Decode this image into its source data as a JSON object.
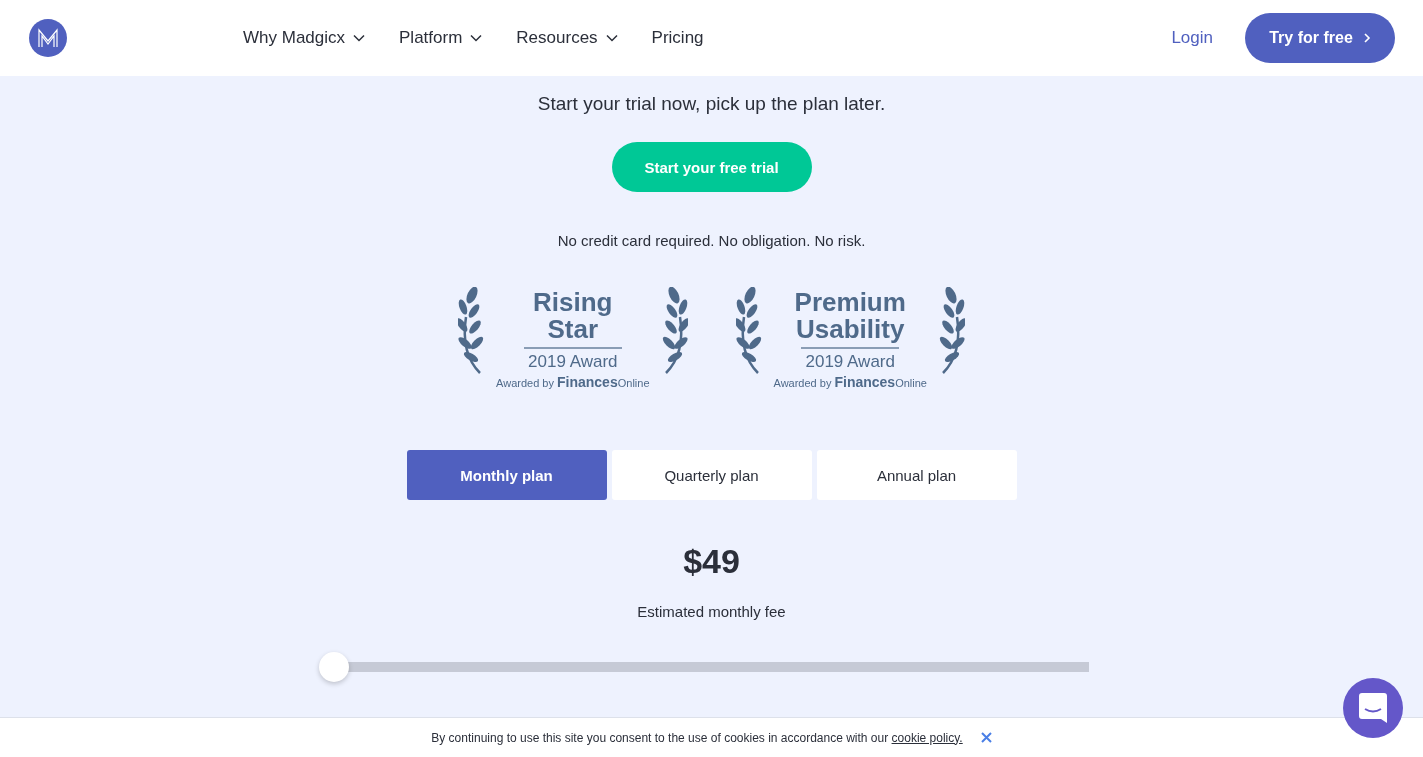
{
  "header": {
    "nav": [
      {
        "label": "Why Madgicx",
        "has_menu": true
      },
      {
        "label": "Platform",
        "has_menu": true
      },
      {
        "label": "Resources",
        "has_menu": true
      },
      {
        "label": "Pricing",
        "has_menu": false
      }
    ],
    "login": "Login",
    "cta": "Try for free"
  },
  "hero": {
    "headline": "Start your trial now, pick up the plan later.",
    "button": "Start your free trial",
    "note": "No credit card required. No obligation. No risk."
  },
  "awards": [
    {
      "title_lines": [
        "Rising",
        "Star"
      ],
      "year": "2019 Award",
      "awarded_by": "Awarded by **Finances**Online"
    },
    {
      "title_lines": [
        "Premium",
        "Usability"
      ],
      "year": "2019 Award",
      "awarded_by": "Awarded by **Finances**Online"
    }
  ],
  "plans": [
    {
      "label": "Monthly plan",
      "selected": true
    },
    {
      "label": "Quarterly plan",
      "selected": false
    },
    {
      "label": "Annual plan",
      "selected": false
    }
  ],
  "price": "$49",
  "price_note": "Estimated monthly fee",
  "spend_slider": {
    "level": 0
  },
  "cookie_bar": {
    "text": "By continuing to use this site you consent to the use of cookies in accordance with our",
    "link": "cookie policy."
  }
}
